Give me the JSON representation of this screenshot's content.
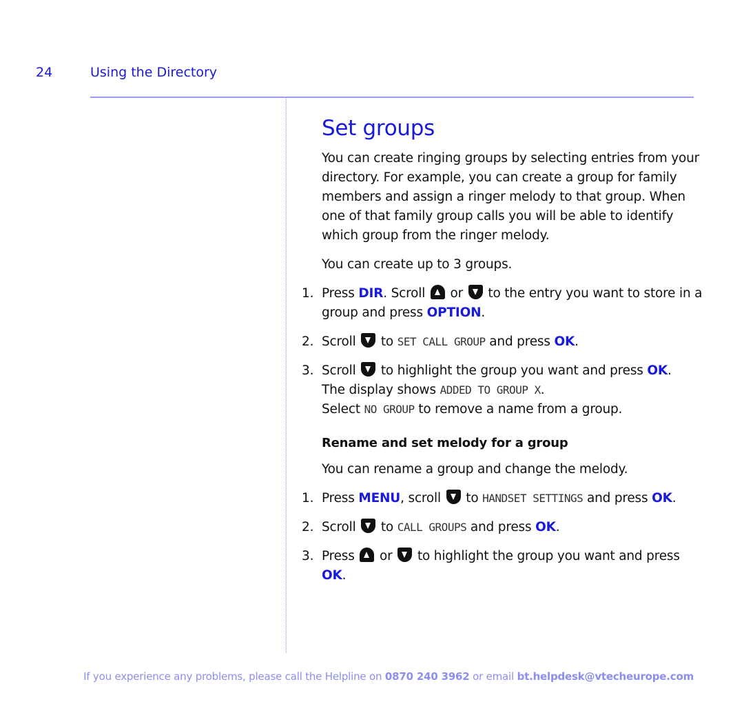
{
  "header": {
    "page_number": "24",
    "section": "Using the Directory"
  },
  "title": "Set groups",
  "intro": "You can create ringing groups by selecting entries from your directory. For example, you can create a group for family members and assign a ringer melody to that group. When one of that family group calls you will be able to identify which group from the ringer melody.",
  "limit_note": "You can create up to 3 groups.",
  "steps": [
    {
      "num": "1.",
      "t1": "Press ",
      "k1": "DIR",
      "t2": ". Scroll ",
      "t3": " or ",
      "t4": " to the entry you want to store in a group and press ",
      "k2": "OPTION",
      "t5": "."
    },
    {
      "num": "2.",
      "t1": "Scroll ",
      "t2": " to ",
      "lcd": "SET CALL GROUP",
      "t3": " and press ",
      "k1": "OK",
      "t4": "."
    },
    {
      "num": "3.",
      "t1": "Scroll ",
      "t2": " to highlight the group you want and press ",
      "k1": "OK",
      "t3": ".",
      "l2a": "The display shows ",
      "lcd1": "ADDED TO GROUP X",
      "l2b": ".",
      "l3a": "Select ",
      "lcd2": "NO GROUP",
      "l3b": " to remove a name from a group."
    }
  ],
  "subheading": "Rename and set melody for a group",
  "rename_intro": "You can rename a group and change the melody.",
  "rename_steps": [
    {
      "num": "1.",
      "t1": "Press ",
      "k1": "MENU",
      "t2": ", scroll ",
      "t3": " to ",
      "lcd": "HANDSET SETTINGS",
      "t4": " and press ",
      "k2": "OK",
      "t5": "."
    },
    {
      "num": "2.",
      "t1": "Scroll ",
      "t2": " to ",
      "lcd": "CALL GROUPS",
      "t3": " and press ",
      "k1": "OK",
      "t4": "."
    },
    {
      "num": "3.",
      "t1": "Press ",
      "t2": " or ",
      "t3": " to highlight the group you want and press ",
      "k1": "OK",
      "t4": "."
    }
  ],
  "footer": {
    "text1": "If you experience any problems, please call the Helpline on ",
    "phone": "0870 240 3962",
    "text2": " or email ",
    "email": "bt.helpdesk@vtecheurope.com"
  },
  "colors": {
    "accent": "#1a1adc",
    "footer": "#8c8ef0",
    "rule": "#9b9bf3"
  }
}
